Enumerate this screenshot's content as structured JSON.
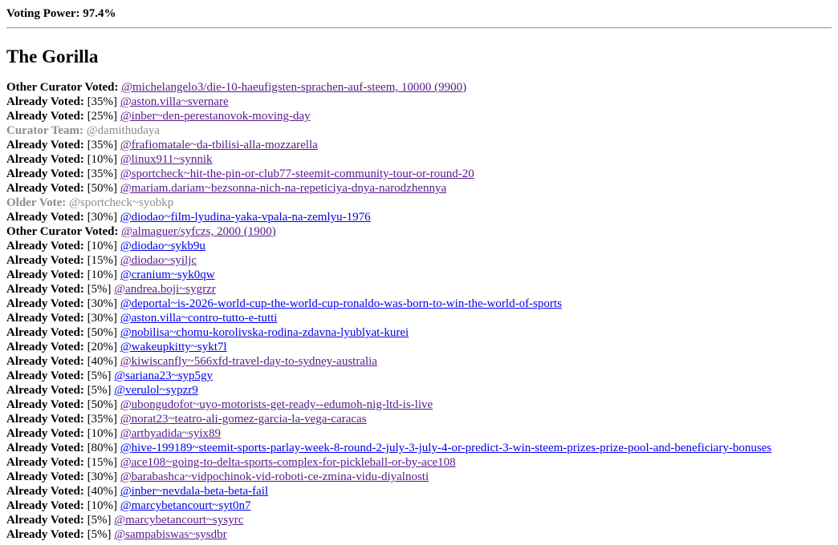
{
  "voting_power": {
    "label": "Voting Power:",
    "value": "97.4%"
  },
  "title": "The Gorilla",
  "rows": [
    {
      "label": "Other Curator Voted:",
      "pct": "",
      "text": "@michelangelo3/die-10-haeufigsten-sprachen-auf-steem, 10000 (9900)",
      "kind": "link"
    },
    {
      "label": "Already Voted:",
      "pct": "[35%]",
      "text": "@aston.villa~svernare",
      "kind": "link"
    },
    {
      "label": "Already Voted:",
      "pct": "[25%]",
      "text": "@inber~den-perestanovok-moving-day",
      "kind": "link"
    },
    {
      "label": "Curator Team:",
      "pct": "",
      "text": "@damithudaya",
      "kind": "muted"
    },
    {
      "label": "Already Voted:",
      "pct": "[35%]",
      "text": "@frafiomatale~da-tbilisi-alla-mozzarella",
      "kind": "link"
    },
    {
      "label": "Already Voted:",
      "pct": "[10%]",
      "text": "@linux911~synnik",
      "kind": "link"
    },
    {
      "label": "Already Voted:",
      "pct": "[35%]",
      "text": "@sportcheck~hit-the-pin-or-club77-steemit-community-tour-or-round-20",
      "kind": "link"
    },
    {
      "label": "Already Voted:",
      "pct": "[50%]",
      "text": "@mariam.dariam~bezsonna-nich-na-repeticiya-dnya-narodzhennya",
      "kind": "link"
    },
    {
      "label": "Older Vote:",
      "pct": "",
      "text": "@sportcheck~syobkp",
      "kind": "muted"
    },
    {
      "label": "Already Voted:",
      "pct": "[30%]",
      "text": "@diodao~film-lyudina-yaka-vpala-na-zemlyu-1976",
      "kind": "fresh"
    },
    {
      "label": "Other Curator Voted:",
      "pct": "",
      "text": "@almaguer/syfczs, 2000 (1900)",
      "kind": "link"
    },
    {
      "label": "Already Voted:",
      "pct": "[10%]",
      "text": "@diodao~sykb9u",
      "kind": "fresh"
    },
    {
      "label": "Already Voted:",
      "pct": "[15%]",
      "text": "@diodao~syiljc",
      "kind": "link"
    },
    {
      "label": "Already Voted:",
      "pct": "[10%]",
      "text": "@cranium~syk0qw",
      "kind": "fresh"
    },
    {
      "label": "Already Voted:",
      "pct": "[5%]",
      "text": "@andrea.boji~sygrzr",
      "kind": "link"
    },
    {
      "label": "Already Voted:",
      "pct": "[30%]",
      "text": "@deportal~is-2026-world-cup-the-world-cup-ronaldo-was-born-to-win-the-world-of-sports",
      "kind": "fresh"
    },
    {
      "label": "Already Voted:",
      "pct": "[30%]",
      "text": "@aston.villa~contro-tutto-e-tutti",
      "kind": "fresh"
    },
    {
      "label": "Already Voted:",
      "pct": "[50%]",
      "text": "@nobilisa~chomu-korolivska-rodina-zdavna-lyublyat-kurei",
      "kind": "fresh"
    },
    {
      "label": "Already Voted:",
      "pct": "[20%]",
      "text": "@wakeupkitty~sykt7l",
      "kind": "fresh"
    },
    {
      "label": "Already Voted:",
      "pct": "[40%]",
      "text": "@kiwiscanfly~566xfd-travel-day-to-sydney-australia",
      "kind": "link"
    },
    {
      "label": "Already Voted:",
      "pct": "[5%]",
      "text": "@sariana23~syp5gy",
      "kind": "fresh"
    },
    {
      "label": "Already Voted:",
      "pct": "[5%]",
      "text": "@verulol~sypzr9",
      "kind": "fresh"
    },
    {
      "label": "Already Voted:",
      "pct": "[50%]",
      "text": "@ubongudofot~uyo-motorists-get-ready--edumoh-nig-ltd-is-live",
      "kind": "link"
    },
    {
      "label": "Already Voted:",
      "pct": "[35%]",
      "text": "@norat23~teatro-ali-gomez-garcia-la-vega-caracas",
      "kind": "link"
    },
    {
      "label": "Already Voted:",
      "pct": "[10%]",
      "text": "@artbyadida~syix89",
      "kind": "link"
    },
    {
      "label": "Already Voted:",
      "pct": "[80%]",
      "text": "@hive-199189~steemit-sports-parlay-week-8-round-2-july-3-july-4-or-predict-3-win-steem-prizes-prize-pool-and-beneficiary-bonuses",
      "kind": "fresh"
    },
    {
      "label": "Already Voted:",
      "pct": "[15%]",
      "text": "@ace108~going-to-delta-sports-complex-for-pickleball-or-by-ace108",
      "kind": "link"
    },
    {
      "label": "Already Voted:",
      "pct": "[30%]",
      "text": "@barabashca~vidpochinok-vid-roboti-ce-zmina-vidu-diyalnosti",
      "kind": "link"
    },
    {
      "label": "Already Voted:",
      "pct": "[40%]",
      "text": "@inber~nevdala-beta-beta-fail",
      "kind": "fresh"
    },
    {
      "label": "Already Voted:",
      "pct": "[10%]",
      "text": "@marcybetancourt~syt0n7",
      "kind": "fresh"
    },
    {
      "label": "Already Voted:",
      "pct": "[5%]",
      "text": "@marcybetancourt~sysyrc",
      "kind": "link"
    },
    {
      "label": "Already Voted:",
      "pct": "[5%]",
      "text": "@sampabiswas~sysdbr",
      "kind": "link"
    }
  ],
  "colors": {
    "visited_link": "#551a8b",
    "unvisited_link": "#0000ee",
    "muted_text": "#8c8c8c"
  }
}
